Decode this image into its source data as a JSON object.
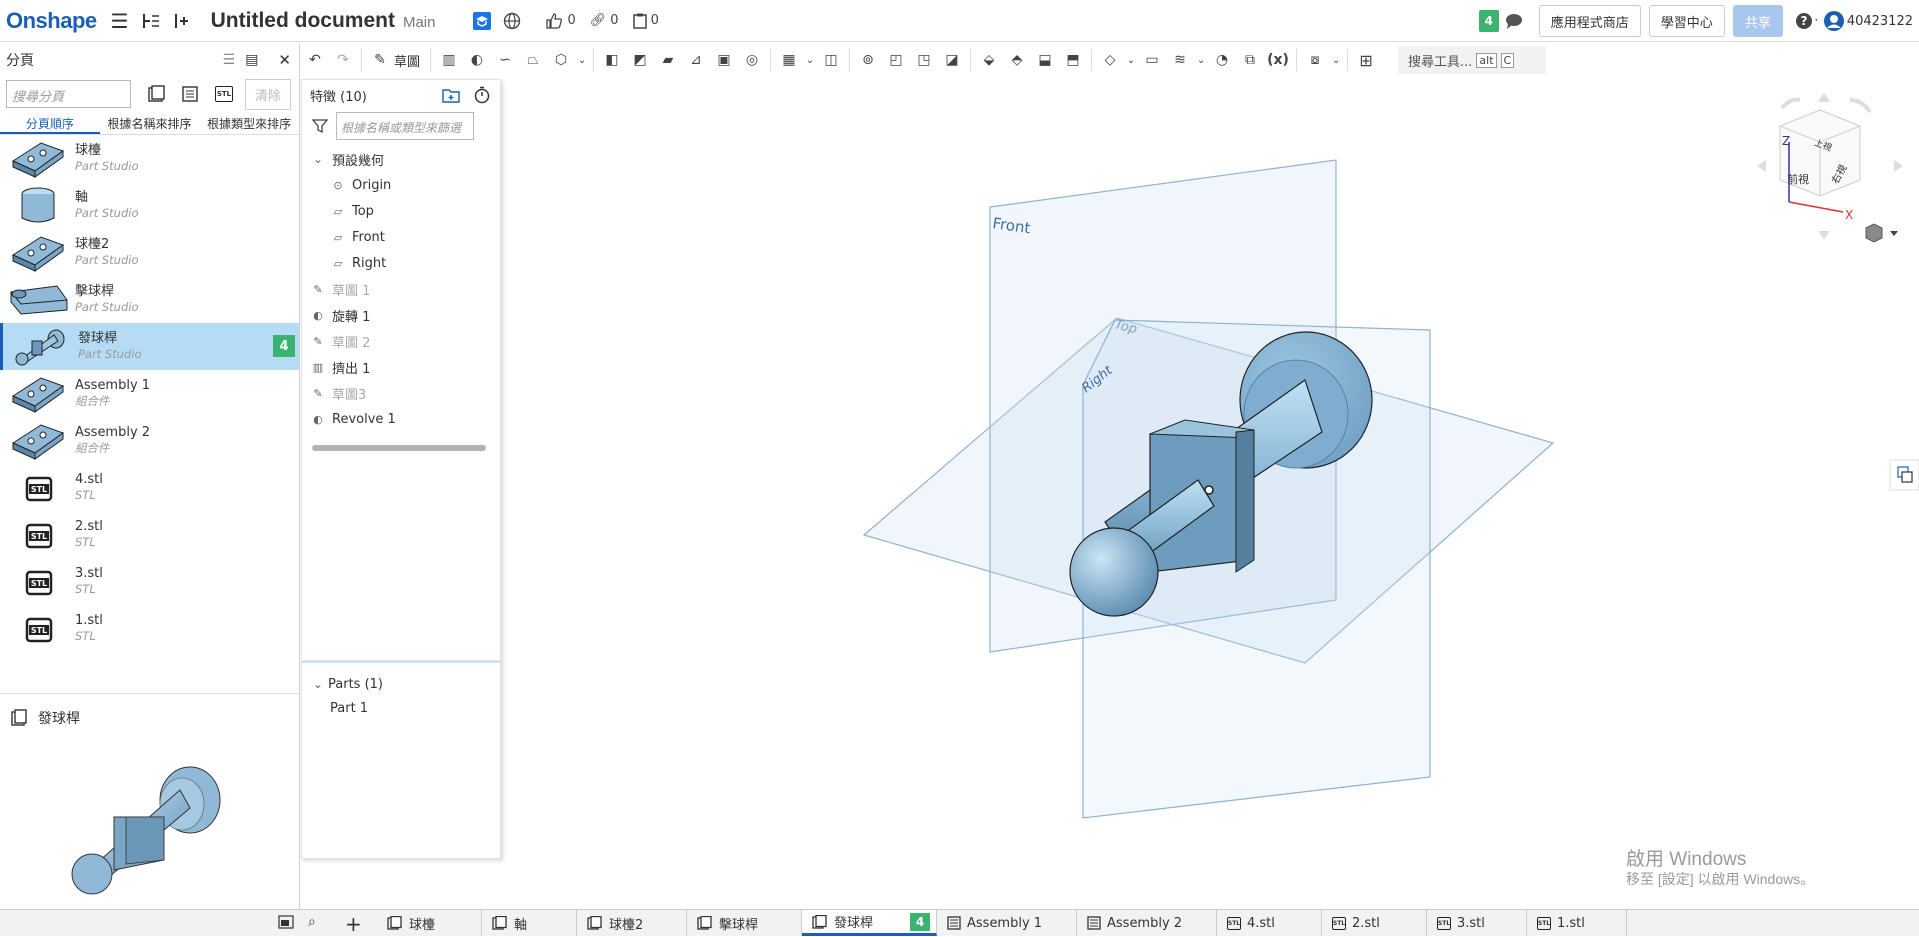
{
  "app": {
    "logo": "Onshape",
    "doc_title": "Untitled document",
    "branch": "Main",
    "likes": "0",
    "links": "0",
    "copies": "0",
    "notif_count": "4",
    "btn_appstore": "應用程式商店",
    "btn_learning": "學習中心",
    "btn_share": "共享",
    "user": "40423122"
  },
  "left_panel": {
    "title": "分頁",
    "search_placeholder": "搜尋分頁",
    "clear_label": "清除",
    "sort_tabs": [
      "分頁順序",
      "根據名稱來排序",
      "根據類型來排序"
    ],
    "items": [
      {
        "name": "球檯",
        "type": "Part Studio",
        "thumb": "plate"
      },
      {
        "name": "軸",
        "type": "Part Studio",
        "thumb": "cylinder"
      },
      {
        "name": "球檯2",
        "type": "Part Studio",
        "thumb": "plate"
      },
      {
        "name": "擊球桿",
        "type": "Part Studio",
        "thumb": "lever"
      },
      {
        "name": "發球桿",
        "type": "Part Studio",
        "thumb": "plunger",
        "selected": true,
        "badge": "4"
      },
      {
        "name": "Assembly 1",
        "type": "組合件",
        "thumb": "plate"
      },
      {
        "name": "Assembly 2",
        "type": "組合件",
        "thumb": "plate"
      },
      {
        "name": "4.stl",
        "type": "STL",
        "thumb": "stl"
      },
      {
        "name": "2.stl",
        "type": "STL",
        "thumb": "stl"
      },
      {
        "name": "3.stl",
        "type": "STL",
        "thumb": "stl"
      },
      {
        "name": "1.stl",
        "type": "STL",
        "thumb": "stl"
      }
    ],
    "preview_title": "發球桿"
  },
  "feature_panel": {
    "title": "特徵 (10)",
    "filter_placeholder": "根據名稱或類型來篩選",
    "group_label": "預設幾何",
    "defaults": [
      "Origin",
      "Top",
      "Front",
      "Right"
    ],
    "features": [
      {
        "label": "草圖 1",
        "icon": "sketch-icon",
        "dim": true
      },
      {
        "label": "旋轉 1",
        "icon": "revolve-icon",
        "dim": false
      },
      {
        "label": "草圖 2",
        "icon": "sketch-icon",
        "dim": true
      },
      {
        "label": "擠出 1",
        "icon": "extrude-icon",
        "dim": false
      },
      {
        "label": "草圖3",
        "icon": "sketch-icon",
        "dim": true
      },
      {
        "label": "Revolve 1",
        "icon": "revolve-icon",
        "dim": false
      }
    ],
    "parts_header": "Parts (1)",
    "parts": [
      "Part 1"
    ]
  },
  "toolbar": {
    "sketch_label": "草圖",
    "search_label": "搜尋工具...",
    "key1": "alt",
    "key2": "C"
  },
  "viewport": {
    "plane_front": "Front",
    "plane_top": "Top",
    "plane_right": "Right",
    "cube_top": "上視",
    "cube_front": "前視",
    "cube_right": "右視",
    "axis_x": "X",
    "axis_z": "Z",
    "watermark": "啟用 Windows",
    "watermark_sub": "移至 [設定] 以啟用 Windows。"
  },
  "bottom_tabs": [
    {
      "label": "球檯",
      "kind": "part"
    },
    {
      "label": "軸",
      "kind": "part"
    },
    {
      "label": "球檯2",
      "kind": "part"
    },
    {
      "label": "擊球桿",
      "kind": "part"
    },
    {
      "label": "發球桿",
      "kind": "part",
      "selected": true,
      "badge": "4"
    },
    {
      "label": "Assembly 1",
      "kind": "asm"
    },
    {
      "label": "Assembly 2",
      "kind": "asm"
    },
    {
      "label": "4.stl",
      "kind": "stl"
    },
    {
      "label": "2.stl",
      "kind": "stl"
    },
    {
      "label": "3.stl",
      "kind": "stl"
    },
    {
      "label": "1.stl",
      "kind": "stl"
    }
  ],
  "colors": {
    "accent": "#1a5fb4",
    "badge": "#3cb371",
    "selected_row": "#b6dcf5",
    "part_blue": "#8fb9d6"
  }
}
